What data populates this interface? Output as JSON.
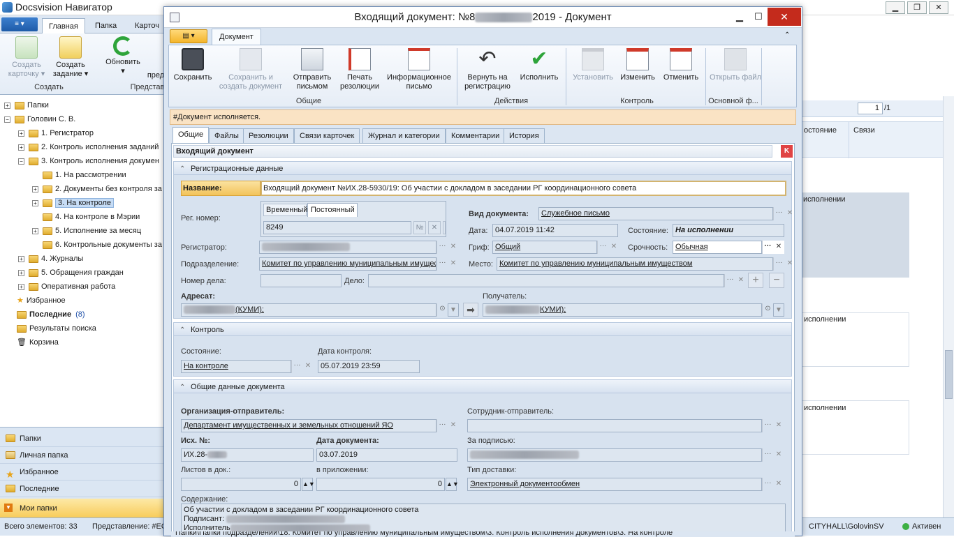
{
  "app": {
    "title": "Docsvision Навигатор",
    "qa_label": "≡ ▾"
  },
  "ribbon": {
    "tabs": [
      "Главная",
      "Папка",
      "Карточ"
    ],
    "create_card": "Создать карточку ▾",
    "create_task": "Создать задание ▾",
    "group_create": "Создать",
    "refresh": "Обновить",
    "refresh_arrow": "▾",
    "pred": "пред",
    "group_present": "Представ"
  },
  "tree": {
    "items": [
      {
        "label": "Папки",
        "depth": 0,
        "expand": "+"
      },
      {
        "label": "Головин С. В.",
        "depth": 0,
        "expand": "−"
      },
      {
        "label": "1. Регистратор",
        "depth": 1,
        "expand": "+"
      },
      {
        "label": "2. Контроль исполнения заданий",
        "depth": 1,
        "expand": "+"
      },
      {
        "label": "3. Контроль исполнения докумен",
        "depth": 1,
        "expand": "−"
      },
      {
        "label": "1. На рассмотрении",
        "depth": 2,
        "expand": ""
      },
      {
        "label": "2. Документы без контроля за",
        "depth": 2,
        "expand": "+"
      },
      {
        "label": "3. На контроле",
        "depth": 2,
        "expand": "+",
        "selected": true
      },
      {
        "label": "4. На контроле в Мэрии",
        "depth": 2,
        "expand": ""
      },
      {
        "label": "5. Исполнение за месяц",
        "depth": 2,
        "expand": "+"
      },
      {
        "label": "6. Контрольные документы за",
        "depth": 2,
        "expand": ""
      },
      {
        "label": "4. Журналы",
        "depth": 1,
        "expand": "+"
      },
      {
        "label": "5. Обращения граждан",
        "depth": 1,
        "expand": "+"
      },
      {
        "label": "Оперативная работа",
        "depth": 1,
        "expand": "+"
      },
      {
        "label": "Избранное",
        "depth": 0,
        "expand": ""
      },
      {
        "label": "Последние",
        "depth": 0,
        "expand": "",
        "count": "(8)"
      },
      {
        "label": "Результаты поиска",
        "depth": 0,
        "expand": ""
      },
      {
        "label": "Корзина",
        "depth": 0,
        "expand": ""
      }
    ]
  },
  "nav": {
    "items": [
      "Папки",
      "Личная папка",
      "Избранное",
      "Последние",
      "Мои папки"
    ]
  },
  "status": {
    "count": "Всего элементов: 33",
    "view": "Представление: #ЕО",
    "user": "CITYHALL\\GolovinSV",
    "state": "Активен"
  },
  "right": {
    "page": "1",
    "pages": "/1",
    "col1": "остояние",
    "col2": "Связи",
    "rows": [
      "исполнении",
      "исполнении",
      "исполнении"
    ]
  },
  "doc": {
    "title_prefix": "Входящий документ: №8",
    "title_suffix": "2019 - Документ",
    "tab": "Документ",
    "buttons": {
      "save": "Сохранить",
      "save_create": "Сохранить и создать документ",
      "send": "Отправить письмом",
      "print": "Печать резолюции",
      "info": "Информационное письмо",
      "return": "Вернуть на регистрацию",
      "exec": "Исполнить",
      "set": "Установить",
      "change": "Изменить",
      "cancel": "Отменить",
      "open": "Открыть файл"
    },
    "groups": {
      "common": "Общие",
      "actions": "Действия",
      "control": "Контроль",
      "main": "Основной ф..."
    },
    "banner": "#Документ исполняется.",
    "ctabs": [
      "Общие",
      "Файлы",
      "Резолюции",
      "Связи карточек",
      "Журнал и категории",
      "Комментарии",
      "История"
    ],
    "card_header": "Входящий документ",
    "reg": {
      "section": "Регистрационные данные",
      "name_label": "Название:",
      "name_value": "Входящий документ №ИХ.28-5930/19: Об участии с докладом в заседании РГ координационного совета",
      "regnum_label": "Рег. номер:",
      "regtab1": "Временный",
      "regtab2": "Постоянный",
      "regnum": "8249",
      "num_sign": "№",
      "doctype_label": "Вид документа:",
      "doctype": "Служебное письмо",
      "date_label": "Дата:",
      "date": "04.07.2019 11:42",
      "state_label": "Состояние:",
      "state": "На исполнении",
      "registrar_label": "Регистратор:",
      "grif_label": "Гриф:",
      "grif": "Общий",
      "urgency_label": "Срочность:",
      "urgency": "Обычная",
      "dept_label": "Подразделение:",
      "dept": "Комитет по управлению муниципальным имуществом",
      "place_label": "Место:",
      "place": "Комитет по управлению муниципальным имуществом",
      "casenum_label": "Номер дела:",
      "case_label": "Дело:",
      "addressee_label": "Адресат:",
      "addressee": "(КУМИ);",
      "recipient_label": "Получатель:",
      "recipient": "КУМИ);"
    },
    "control": {
      "section": "Контроль",
      "state_label": "Состояние:",
      "state": "На контроле",
      "date_label": "Дата контроля:",
      "date": "05.07.2019 23:59"
    },
    "general": {
      "section": "Общие данные документа",
      "org_label": "Организация-отправитель:",
      "org": "Департамент имущественных и земельных отношений ЯО",
      "emp_label": "Сотрудник-отправитель:",
      "out_label": "Исх. №:",
      "out": "ИХ.28-",
      "docdate_label": "Дата документа:",
      "docdate": "03.07.2019",
      "sign_label": "За подписью:",
      "sheets_label": "Листов в док.:",
      "sheets": "0",
      "app_label": "в приложении:",
      "app": "0",
      "delivery_label": "Тип доставки:",
      "delivery": "Электронный документообмен",
      "content_label": "Содержание:",
      "content1": "Об участии с докладом в заседании РГ координационного совета",
      "content2": "Подписант:",
      "content3": "Исполнитель"
    },
    "path": "Папки\\Папки подразделений\\18. Комитет по управлению муниципальным имуществом\\3. Контроль исполнения документов\\3. На контроле"
  },
  "colors": {
    "accent": "#1e5ba8",
    "banner": "#fae3c4",
    "selected": "#c6dcf5"
  }
}
